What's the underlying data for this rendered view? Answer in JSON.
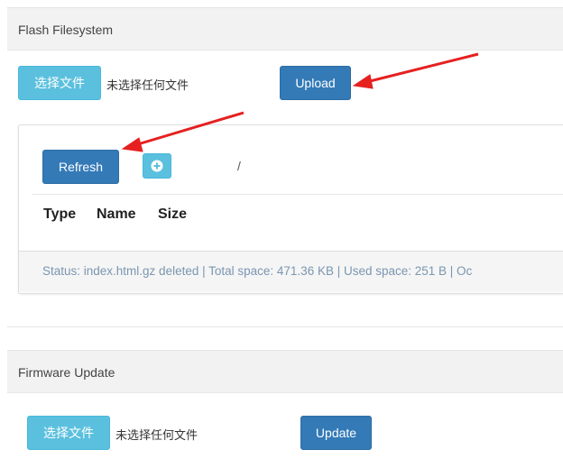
{
  "flash_fs": {
    "title": "Flash Filesystem",
    "choose_file_label": "选择文件",
    "no_file_text": "未选择任何文件",
    "upload_label": "Upload"
  },
  "file_manager": {
    "refresh_label": "Refresh",
    "new_folder_icon": "plus-icon",
    "current_path": "/",
    "columns": [
      "Type",
      "Name",
      "Size"
    ],
    "status": "Status: index.html.gz deleted  |  Total space: 471.36 KB  |  Used space: 251 B  |  Oc"
  },
  "firmware": {
    "title": "Firmware Update",
    "choose_file_label": "选择文件",
    "no_file_text": "未选择任何文件",
    "update_label": "Update"
  },
  "annotations": {
    "arrow_color": "#e62020"
  },
  "colors": {
    "info": "#5bc0de",
    "primary": "#337ab7",
    "panel_bg": "#f2f2f2",
    "status_text": "#7a96b0"
  }
}
